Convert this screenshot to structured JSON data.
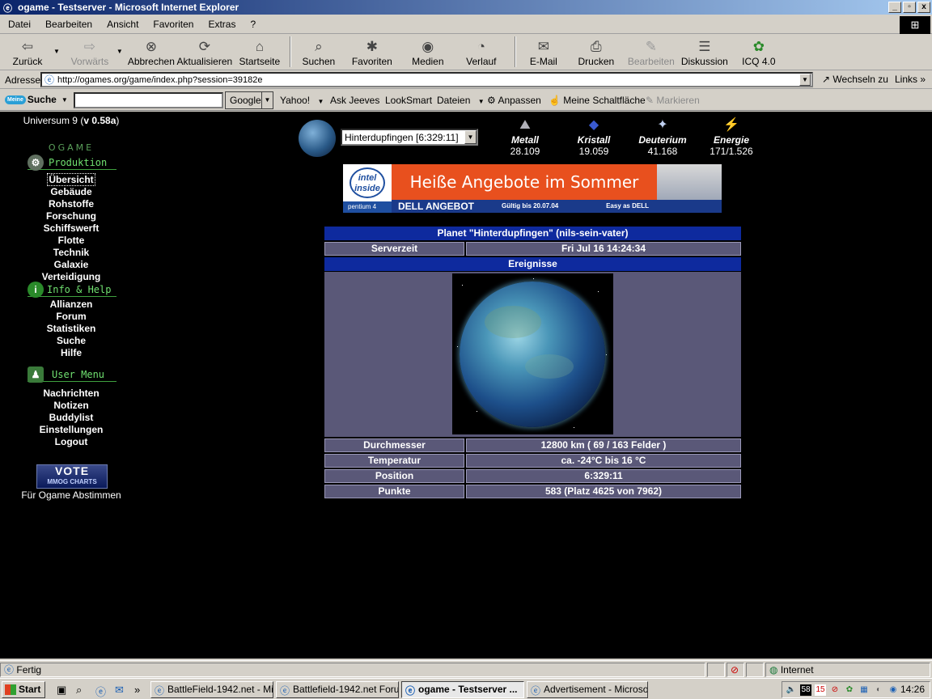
{
  "window": {
    "title": "ogame - Testserver - Microsoft Internet Explorer",
    "controls": [
      "_",
      "▫",
      "x"
    ]
  },
  "menubar": [
    "Datei",
    "Bearbeiten",
    "Ansicht",
    "Favoriten",
    "Extras",
    "?"
  ],
  "toolbar": {
    "back": "Zurück",
    "forward": "Vorwärts",
    "stop": "Abbrechen",
    "refresh": "Aktualisieren",
    "home": "Startseite",
    "search": "Suchen",
    "favorites": "Favoriten",
    "media": "Medien",
    "history": "Verlauf",
    "mail": "E-Mail",
    "print": "Drucken",
    "edit": "Bearbeiten",
    "discuss": "Diskussion",
    "icq": "ICQ 4.0"
  },
  "addressbar": {
    "label": "Adresse",
    "url": "http://ogames.org/game/index.php?session=39182e",
    "go": "Wechseln zu",
    "links": "Links"
  },
  "searchbar": {
    "logo_badge": "Meine",
    "logo_text": "Suche",
    "engine": "Google",
    "yahoo": "Yahoo!",
    "ask": "Ask Jeeves",
    "looksmart": "LookSmart",
    "files": "Dateien",
    "customize": "Anpassen",
    "my_button": "Meine Schaltfläche",
    "highlight": "Markieren"
  },
  "game": {
    "universe_prefix": "Universum 9 (",
    "version_v": "v",
    "version": " 0.58a",
    "universe_suffix": ")",
    "logo": "OGAME",
    "sections": {
      "production": "Produktion",
      "info": "Info & Help",
      "user": "User Menu"
    },
    "nav_production": [
      "Übersicht",
      "Gebäude",
      "Rohstoffe",
      "Forschung",
      "Schiffswerft",
      "Flotte",
      "Technik",
      "Galaxie",
      "Verteidigung"
    ],
    "nav_info": [
      "Allianzen",
      "Forum",
      "Statistiken",
      "Suche",
      "Hilfe"
    ],
    "nav_user": [
      "Nachrichten",
      "Notizen",
      "Buddylist",
      "Einstellungen",
      "Logout"
    ],
    "vote": {
      "title": "VOTE",
      "subtitle": "MMOG CHARTS",
      "caption": "Für Ogame Abstimmen"
    },
    "planet_select": "Hinterdupfingen [6:329:11]",
    "resources": [
      {
        "name": "Metall",
        "value": "28.109",
        "icon": "metal-icon"
      },
      {
        "name": "Kristall",
        "value": "19.059",
        "icon": "crystal-icon"
      },
      {
        "name": "Deuterium",
        "value": "41.168",
        "icon": "deuterium-icon"
      },
      {
        "name": "Energie",
        "value": "171/1.526",
        "icon": "energy-icon"
      }
    ],
    "banner": {
      "intel": "intel inside",
      "pentium": "pentium 4",
      "headline": "Heiße Angebote im Sommer",
      "dell": "DELL ANGEBOT",
      "valid": "Gültig bis 20.07.04",
      "easy": "Easy as DELL"
    },
    "overview": {
      "title": "Planet \"Hinterdupfingen\" (nils-sein-vater)",
      "server_time_label": "Serverzeit",
      "server_time": "Fri Jul 16 14:24:34",
      "events": "Ereignisse",
      "rows": [
        {
          "label": "Durchmesser",
          "value": "12800 km ( 69 / 163 Felder )"
        },
        {
          "label": "Temperatur",
          "value": "ca. -24°C bis 16 °C"
        },
        {
          "label": "Position",
          "value": "6:329:11"
        },
        {
          "label": "Punkte",
          "value": "583 (Platz 4625 von 7962)"
        }
      ]
    }
  },
  "statusbar": {
    "status": "Fertig",
    "zone": "Internet"
  },
  "taskbar": {
    "start": "Start",
    "tasks": [
      {
        "label": "BattleField-1942.net - Mi...",
        "active": false
      },
      {
        "label": "Battlefield-1942.net Foru...",
        "active": false
      },
      {
        "label": "ogame - Testserver ...",
        "active": true
      },
      {
        "label": "Advertisement - Microsof...",
        "active": false
      }
    ],
    "clock": "14:26",
    "tray_badge_1": "58",
    "tray_badge_2": "15"
  }
}
